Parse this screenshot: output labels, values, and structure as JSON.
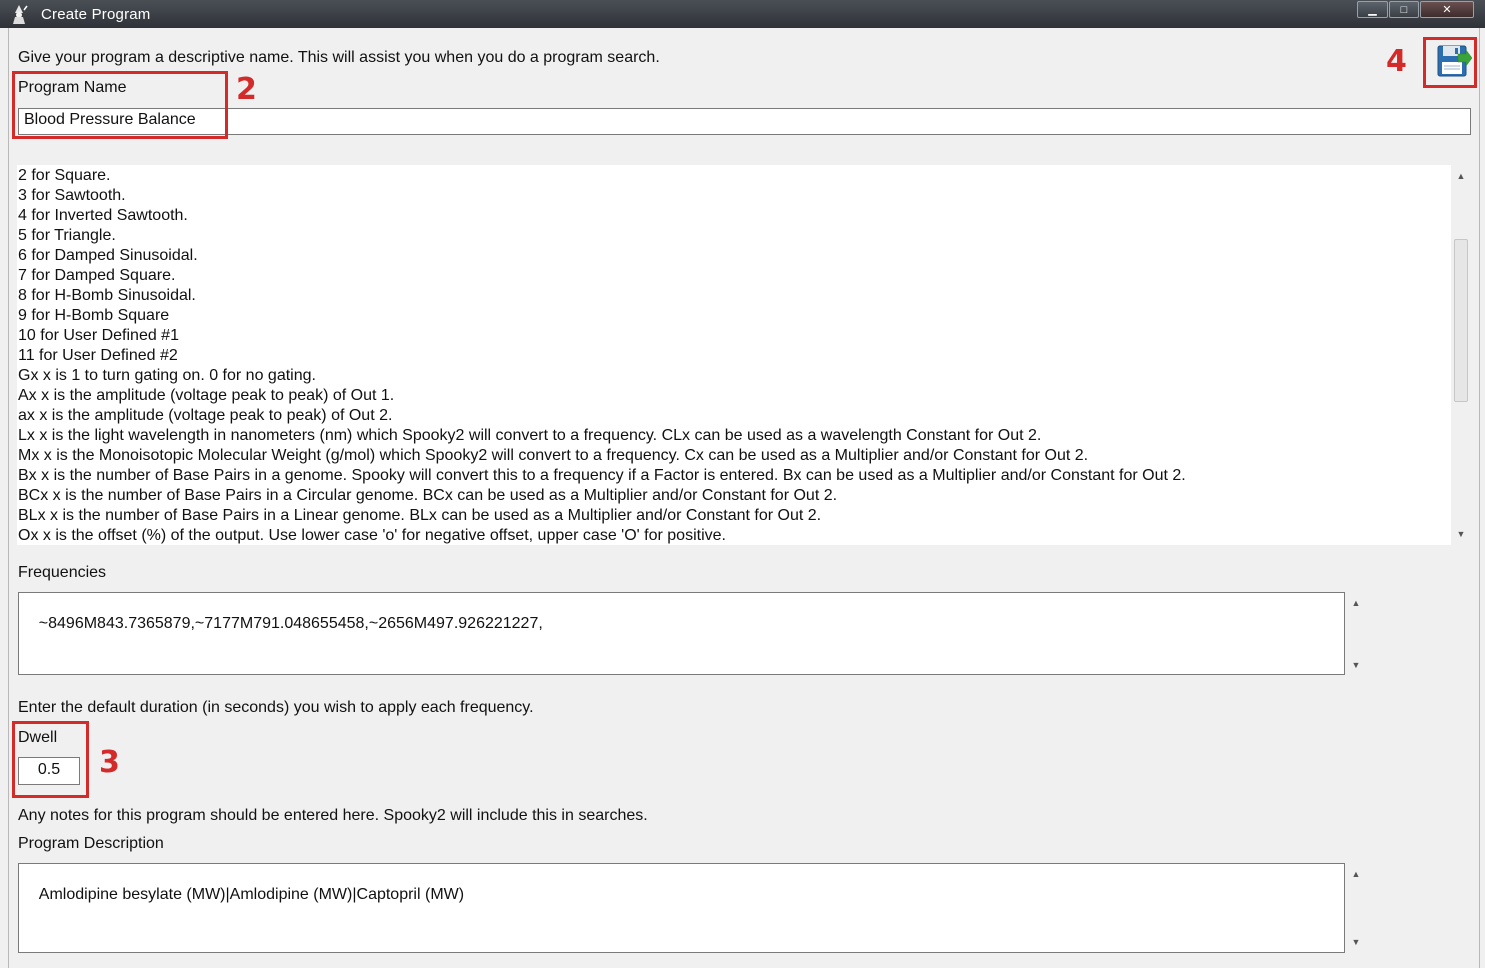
{
  "window": {
    "title": "Create Program",
    "controls": {
      "minimize": "▁",
      "maximize": "□",
      "close": "✕"
    }
  },
  "name_section": {
    "instruction": "Give your program a descriptive name. This will assist you when you do a program search.",
    "label": "Program Name",
    "value": "Blood Pressure Balance"
  },
  "help_lines": [
    "2 for Square.",
    "3 for Sawtooth.",
    "4 for Inverted Sawtooth.",
    "5 for Triangle.",
    "6 for Damped Sinusoidal.",
    "7 for Damped Square.",
    "8 for H-Bomb Sinusoidal.",
    "9 for H-Bomb Square",
    "10 for User Defined #1",
    "11 for User Defined #2",
    "Gx  x is 1 to turn gating on. 0 for no gating.",
    "Ax  x is the amplitude (voltage peak to peak) of Out 1.",
    "ax  x is the amplitude (voltage peak to peak) of Out 2.",
    "Lx  x is the light wavelength in nanometers (nm) which Spooky2 will convert to a frequency. CLx can be used as a wavelength Constant for Out 2.",
    "Mx  x is the Monoisotopic Molecular Weight (g/mol) which Spooky2 will convert to a frequency. Cx can be used as a Multiplier and/or Constant for Out 2.",
    "Bx  x is the number of Base Pairs in a genome. Spooky will convert this to a frequency if a Factor is entered. Bx can be used as a Multiplier and/or Constant for Out 2.",
    "BCx x is the number of Base Pairs in a Circular genome. BCx can be used as a Multiplier and/or Constant for Out 2.",
    "BLx x is the number of Base Pairs in a Linear genome. BLx can be used as a Multiplier and/or Constant for Out 2.",
    "Ox  x is the offset (%) of the output. Use lower case 'o' for negative offset, upper case 'O' for positive."
  ],
  "frequencies": {
    "label": "Frequencies",
    "value": "~8496M843.7365879,~7177M791.048655458,~2656M497.926221227,"
  },
  "dwell_section": {
    "instruction": "Enter the default duration (in seconds) you wish to apply each frequency.",
    "label": "Dwell",
    "value": "0.5"
  },
  "description_section": {
    "instruction": "Any notes for this program should be entered here. Spooky2 will include this in searches.",
    "label": "Program Description",
    "value": "Amlodipine besylate (MW)|Amlodipine (MW)|Captopril (MW)"
  },
  "annotations": {
    "name_marker": "2",
    "dwell_marker": "3",
    "save_marker": "4"
  },
  "icons": {
    "app": "wizard-icon",
    "save": "save-floppy-icon"
  },
  "colors": {
    "annotation": "#d32a2a",
    "titlebar": "#3a3f45",
    "floppy_blue": "#2b6fb0",
    "arrow_green": "#3aa43a"
  }
}
